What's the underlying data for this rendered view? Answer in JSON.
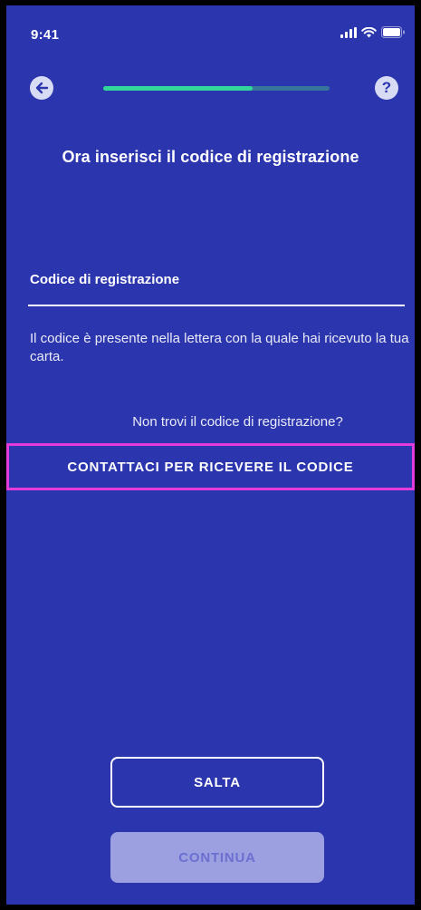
{
  "status_bar": {
    "time": "9:41"
  },
  "progress": {
    "fraction": 0.66
  },
  "nav": {
    "back_icon": "arrow-left-icon",
    "help_label": "?"
  },
  "page": {
    "title": "Ora inserisci il codice di registrazione"
  },
  "form": {
    "field_label": "Codice di registrazione",
    "field_value": "",
    "helper_text": "Il codice è presente nella lettera con la quale hai ricevuto la tua carta."
  },
  "help_section": {
    "question": "Non trovi il codice di registrazione?",
    "contact_label": "CONTATTACI PER RICEVERE IL CODICE"
  },
  "actions": {
    "skip_label": "SALTA",
    "continue_label": "CONTINUA"
  },
  "colors": {
    "background": "#2b35ad",
    "progress": "#33d69a",
    "highlight": "#e53bd9"
  }
}
